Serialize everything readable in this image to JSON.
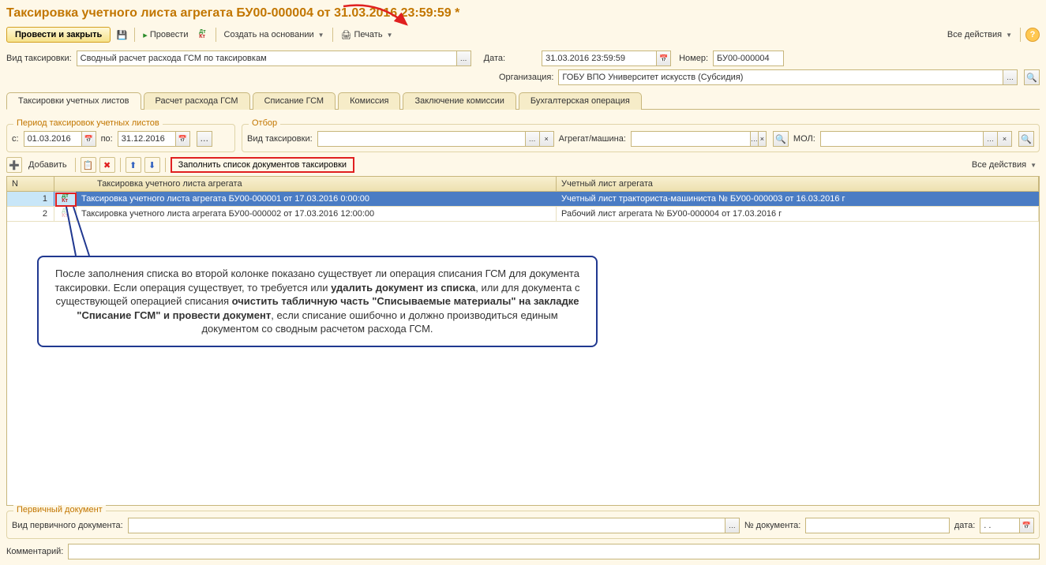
{
  "title": "Таксировка учетного листа агрегата БУ00-000004 от 31.03.2016 23:59:59 *",
  "toolbar": {
    "post_close": "Провести и закрыть",
    "post": "Провести",
    "create_based": "Создать на основании",
    "print": "Печать",
    "all_actions": "Все действия"
  },
  "form": {
    "taxing_type_label": "Вид таксировки:",
    "taxing_type_value": "Сводный расчет расхода ГСМ по таксировкам",
    "date_label": "Дата:",
    "date_value": "31.03.2016 23:59:59",
    "number_label": "Номер:",
    "number_value": "БУ00-000004",
    "org_label": "Организация:",
    "org_value": "ГОБУ ВПО Университет искусств (Субсидия)"
  },
  "tabs": [
    "Таксировки учетных листов",
    "Расчет расхода ГСМ",
    "Списание ГСМ",
    "Комиссия",
    "Заключение комиссии",
    "Бухгалтерская операция"
  ],
  "period_group": {
    "title": "Период таксировок учетных листов",
    "from_label": "с:",
    "from_value": "01.03.2016",
    "to_label": "по:",
    "to_value": "31.12.2016"
  },
  "filter_group": {
    "title": "Отбор",
    "taxing_type_label": "Вид таксировки:",
    "unit_label": "Агрегат/машина:",
    "mol_label": "МОЛ:"
  },
  "table_toolbar": {
    "add": "Добавить",
    "fill_list": "Заполнить список документов таксировки",
    "all_actions": "Все действия"
  },
  "table": {
    "headers": {
      "n": "N",
      "doc": "Таксировка учетного листа агрегата",
      "sheet": "Учетный лист агрегата"
    },
    "rows": [
      {
        "n": "1",
        "doc": "Таксировка учетного листа агрегата БУ00-000001 от 17.03.2016 0:00:00",
        "sheet": "Учетный лист тракториста-машиниста № БУ00-000003 от 16.03.2016 г"
      },
      {
        "n": "2",
        "doc": "Таксировка учетного листа агрегата БУ00-000002 от 17.03.2016 12:00:00",
        "sheet": "Рабочий лист агрегата № БУ00-000004 от 17.03.2016 г"
      }
    ]
  },
  "callout": {
    "t1": "После заполнения списка во второй колонке показано существует ли операция списания ГСМ для документа таксировки. Если операция существует, то требуется или ",
    "b1": "удалить документ из списка",
    "t2": ", или для документа с существующей операцией списания ",
    "b2": "очистить табличную часть \"Списываемые материалы\" на закладке \"Списание ГСМ\" и провести документ",
    "t3": ", если списание ошибочно и должно производиться единым документом со сводным расчетом расхода ГСМ."
  },
  "primary_doc": {
    "title": "Первичный документ",
    "type_label": "Вид первичного документа:",
    "number_label": "№ документа:",
    "date_label": "дата:",
    "date_value": ". ."
  },
  "comment_label": "Комментарий:"
}
